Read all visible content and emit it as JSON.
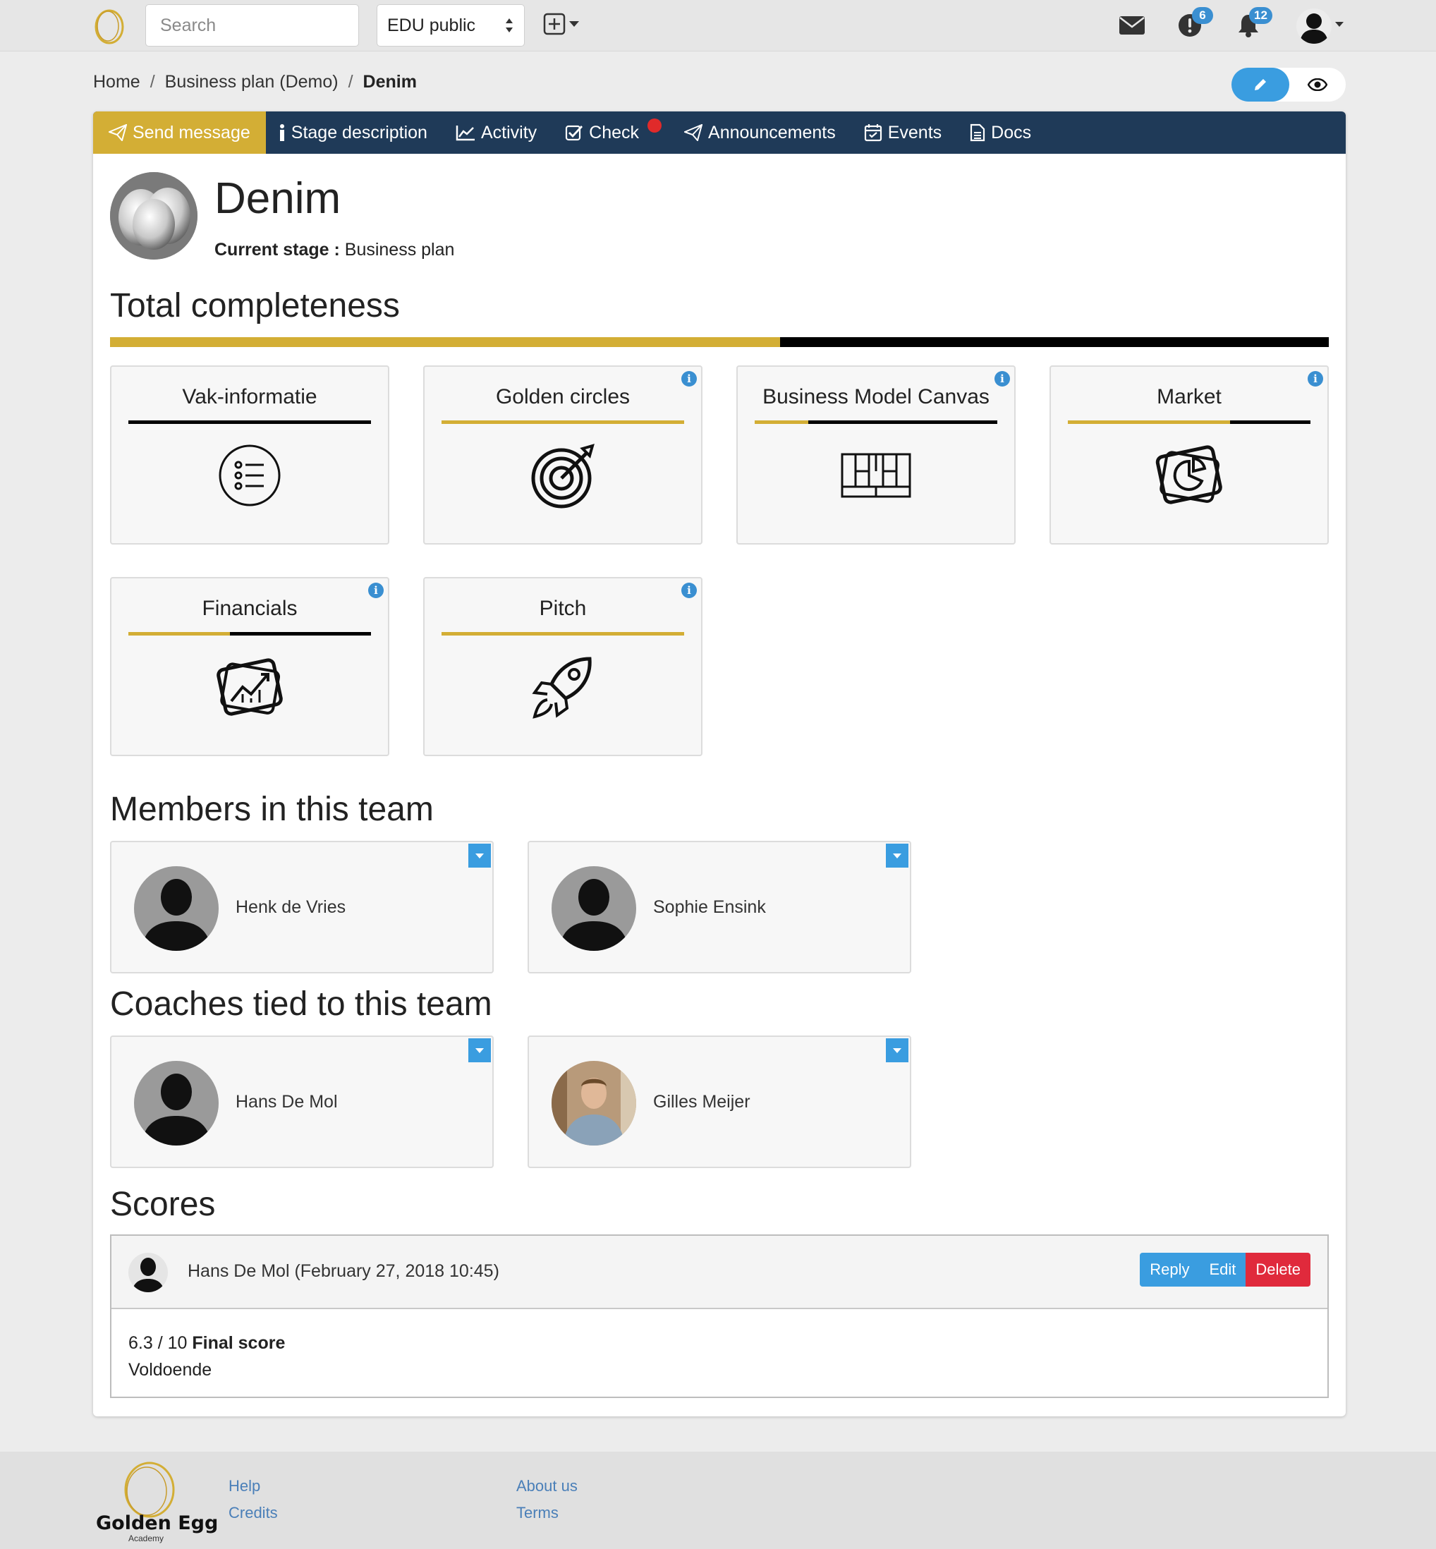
{
  "topbar": {
    "search_placeholder": "Search",
    "space_select": "EDU public",
    "messages_icon": "envelope-icon",
    "alerts_badge": "6",
    "notifications_badge": "12"
  },
  "breadcrumb": {
    "home": "Home",
    "parent": "Business plan (Demo)",
    "current": "Denim"
  },
  "tabs": [
    {
      "label": "Send message",
      "icon": "paper-plane-icon"
    },
    {
      "label": "Stage description",
      "icon": "info-icon"
    },
    {
      "label": "Activity",
      "icon": "line-chart-icon"
    },
    {
      "label": "Check",
      "icon": "check-square-icon"
    },
    {
      "label": "Announcements",
      "icon": "paper-plane-icon"
    },
    {
      "label": "Events",
      "icon": "calendar-check-icon"
    },
    {
      "label": "Docs",
      "icon": "document-icon"
    }
  ],
  "team": {
    "name": "Denim",
    "stage_label": "Current stage :",
    "stage_value": "Business plan"
  },
  "completeness": {
    "title": "Total completeness",
    "progress": 0.55
  },
  "modules": [
    {
      "title": "Vak-informatie",
      "progress": 0.0,
      "info": false,
      "icon": "list-icon"
    },
    {
      "title": "Golden circles",
      "progress": 1.0,
      "info": true,
      "icon": "target-icon"
    },
    {
      "title": "Business Model Canvas",
      "progress": 0.22,
      "info": true,
      "icon": "canvas-grid-icon"
    },
    {
      "title": "Market",
      "progress": 0.67,
      "info": true,
      "icon": "market-pie-icon"
    },
    {
      "title": "Financials",
      "progress": 0.42,
      "info": true,
      "icon": "financial-chart-icon"
    },
    {
      "title": "Pitch",
      "progress": 1.0,
      "info": true,
      "icon": "rocket-icon"
    }
  ],
  "members": {
    "title": "Members in this team",
    "people": [
      {
        "name": "Henk de Vries"
      },
      {
        "name": "Sophie Ensink"
      }
    ]
  },
  "coaches": {
    "title": "Coaches tied to this team",
    "people": [
      {
        "name": "Hans De Mol"
      },
      {
        "name": "Gilles Meijer"
      }
    ]
  },
  "scores": {
    "title": "Scores",
    "author": "Hans De Mol (February 27, 2018 10:45)",
    "reply": "Reply",
    "edit": "Edit",
    "delete": "Delete",
    "value": "6.3 / 10",
    "value_label": "Final score",
    "verdict": "Voldoende"
  },
  "footer": {
    "brand": "Golden Egg",
    "brand_sub": "Academy",
    "links": [
      "Help",
      "Credits",
      "About us",
      "Terms"
    ]
  },
  "colors": {
    "gold": "#d3ae35",
    "navy": "#1f3a58",
    "blue": "#3a9de0",
    "red": "#e02a3c"
  }
}
